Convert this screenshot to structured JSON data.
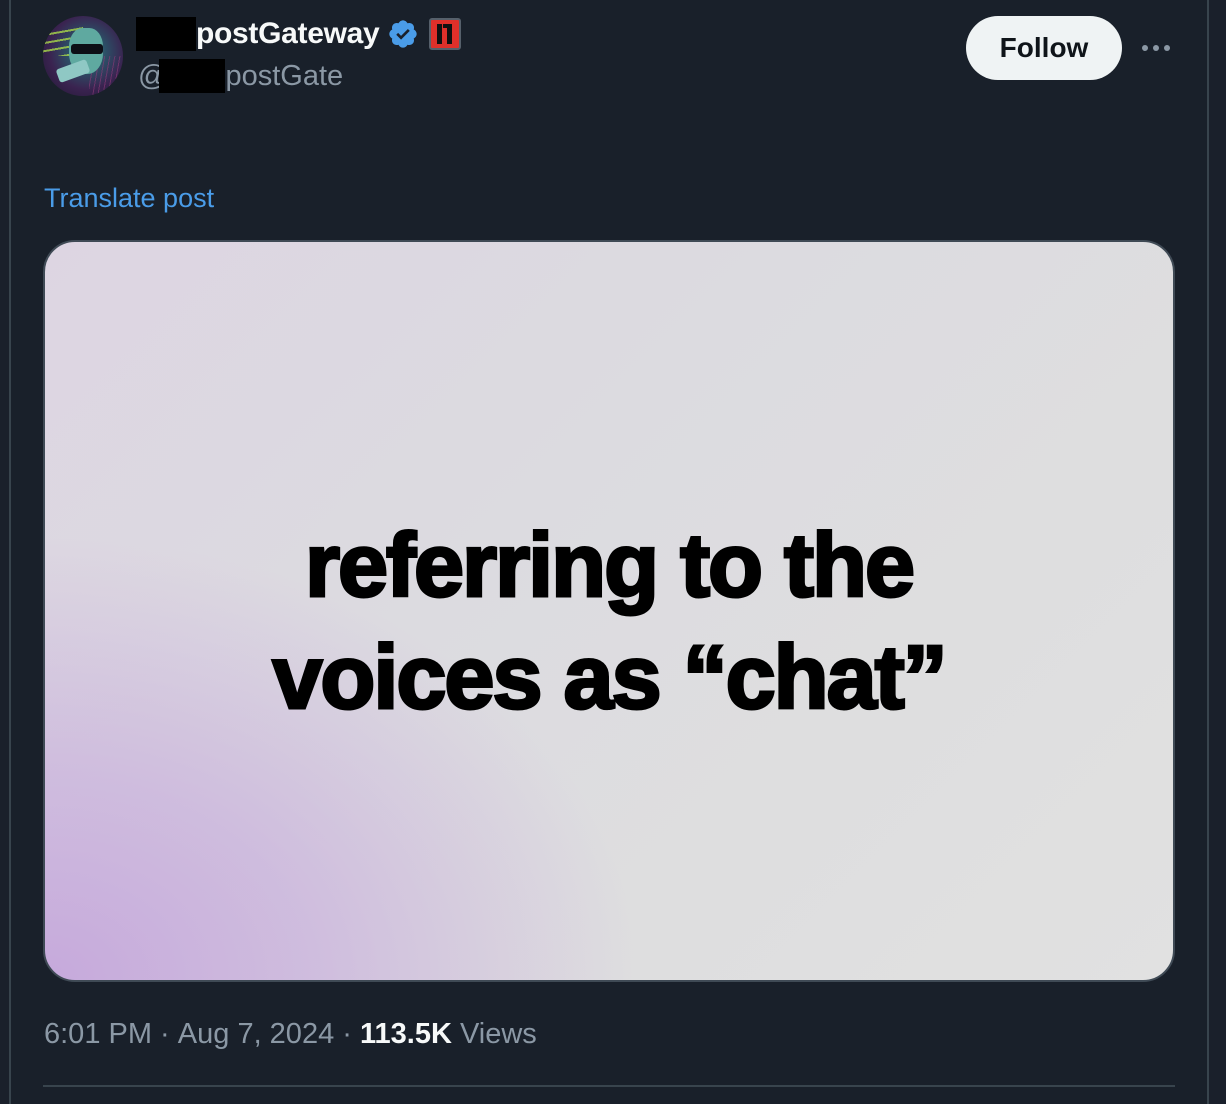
{
  "author": {
    "display_name_visible": "postGateway",
    "display_name_prefix_redacted": true,
    "handle_prefix": "@",
    "handle_visible": "postGate",
    "handle_redacted": true,
    "verified": true,
    "verified_color": "#4a9ce8",
    "affiliate_badge_color": "#e0302a",
    "avatar_icon": "avatar-image"
  },
  "actions": {
    "follow_label": "Follow",
    "more_icon": "more-horizontal-icon"
  },
  "post": {
    "translate_label": "Translate post",
    "media_text_lines": [
      "referring to the",
      "voices as “chat”"
    ]
  },
  "meta": {
    "time": "6:01 PM",
    "separator": " · ",
    "date": "Aug 7, 2024",
    "views_count": "113.5K",
    "views_label": " Views"
  },
  "colors": {
    "background": "#19202a",
    "link": "#4a9ce8",
    "secondary_text": "#8b98a5",
    "primary_text": "#f7f9f9",
    "border": "#38444d"
  }
}
